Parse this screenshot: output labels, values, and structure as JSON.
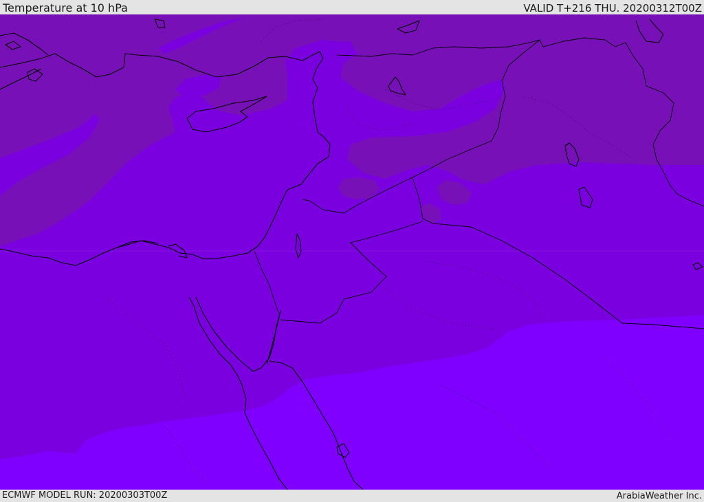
{
  "header": {
    "title": "Temperature at 10 hPa",
    "valid": "VALID T+216 THU. 20200312T00Z"
  },
  "footer": {
    "model_run": "ECMWF MODEL RUN: 20200303T00Z",
    "provider": "ArabiaWeather Inc."
  },
  "map": {
    "colors": {
      "band_cold": "#7810b8",
      "band_mid": "#7a00e0",
      "band_warm": "#7f00ff",
      "coastline": "#000000"
    }
  }
}
